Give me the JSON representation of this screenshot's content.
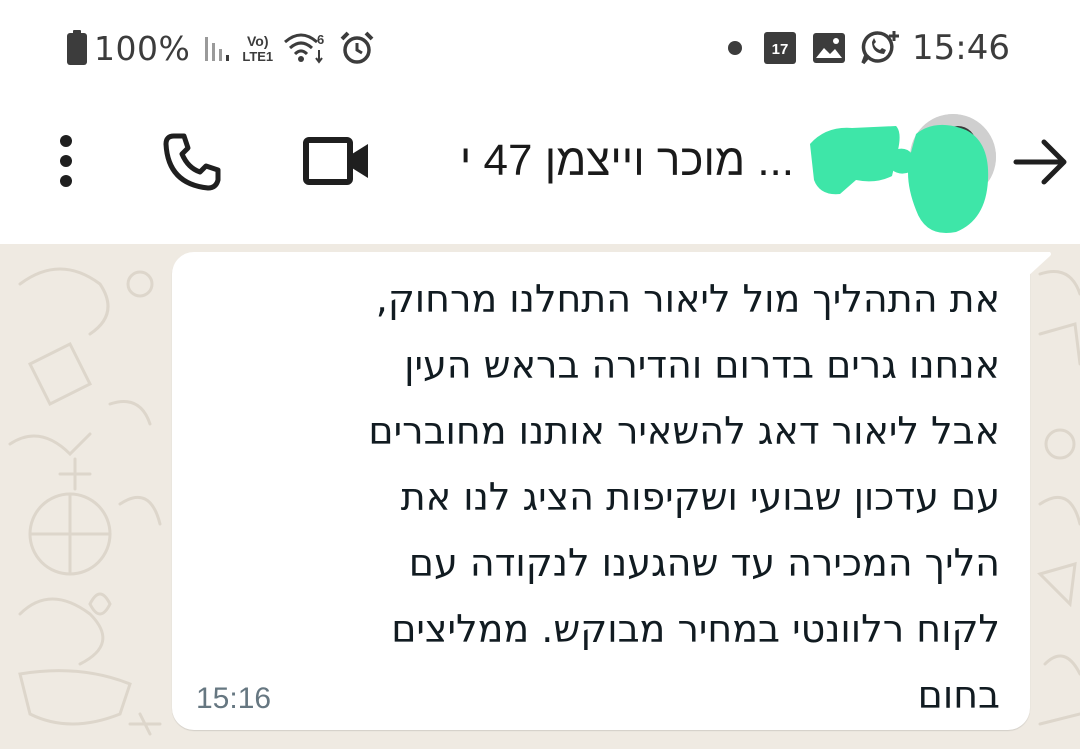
{
  "status_bar": {
    "battery": "100%",
    "volte": "Vo)",
    "lte": "LTE1",
    "calendar_day": "17",
    "time": "15:46",
    "icons": [
      "battery-icon",
      "signal-icon",
      "wifi-icon",
      "alarm-icon",
      "dot-icon",
      "calendar-icon",
      "gallery-icon",
      "whatsapp-icon"
    ]
  },
  "header": {
    "contact_name": "‫... מוכר וייצמן 47 י‬",
    "icons": [
      "menu-icon",
      "phone-icon",
      "video-icon",
      "back-arrow-icon"
    ],
    "redaction_color": "#3ee6a8"
  },
  "message": {
    "text": "את התהליך מול ליאור התחלנו מרחוק,\nאנחנו גרים בדרום והדירה בראש העין\nאבל ליאור דאג להשאיר אותנו מחוברים\nעם עדכון שבועי ושקיפות הציג לנו את\nהליך המכירה עד שהגענו לנקודה עם\nלקוח רלוונטי במחיר מבוקש. ממליצים\nבחום",
    "time": "15:16"
  },
  "colors": {
    "chat_background": "#efeae2",
    "bubble": "#ffffff",
    "icon": "#1f1f1f"
  }
}
